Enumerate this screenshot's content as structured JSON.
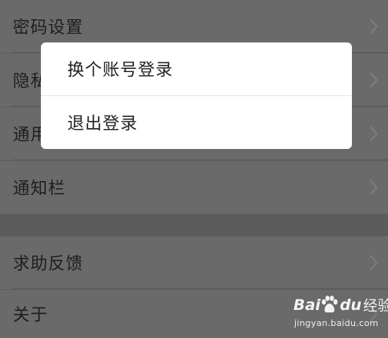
{
  "settings": {
    "rows": [
      {
        "label": "密码设置"
      },
      {
        "label": "隐私"
      },
      {
        "label": "通用"
      },
      {
        "label": "通知栏"
      },
      {
        "label": "求助反馈"
      },
      {
        "label": "关于"
      }
    ]
  },
  "dialog": {
    "items": [
      {
        "label": "换个账号登录"
      },
      {
        "label": "退出登录"
      }
    ]
  },
  "watermark": {
    "brand_bai": "Bai",
    "brand_du": "du",
    "brand_jingyan": "经验",
    "url": "jingyan.baidu.com"
  },
  "colors": {
    "overlay_row": "#6a6a6a",
    "overlay_gap": "#5c5c5c",
    "dialog_bg": "#ffffff",
    "text_dark": "#1e1e1e"
  },
  "icons": {
    "row_chevron": "chevron-right-icon",
    "watermark_logo": "baidu-paw-icon"
  }
}
